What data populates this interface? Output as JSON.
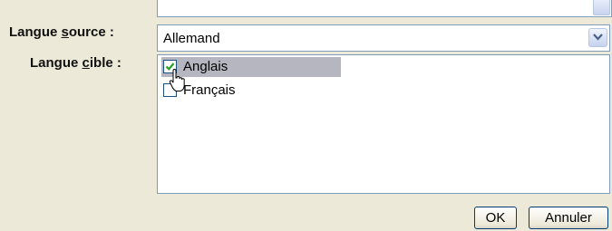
{
  "form": {
    "source_language": {
      "label_main": "Langue ",
      "label_accel": "s",
      "label_rest": "ource :",
      "value": "Allemand"
    },
    "target_language": {
      "label_main": "Langue ",
      "label_accel": "c",
      "label_rest": "ible :",
      "items": [
        {
          "label": "Anglais",
          "checked": true,
          "highlighted": true
        },
        {
          "label": "Français",
          "checked": false,
          "highlighted": false
        }
      ]
    }
  },
  "buttons": {
    "ok": "OK",
    "cancel": "Annuler"
  },
  "colors": {
    "dialog_background": "#ece9d8",
    "field_border": "#7f9db9",
    "highlight": "#b6b6c0",
    "checkmark": "#21a121",
    "button_border": "#003c74"
  }
}
